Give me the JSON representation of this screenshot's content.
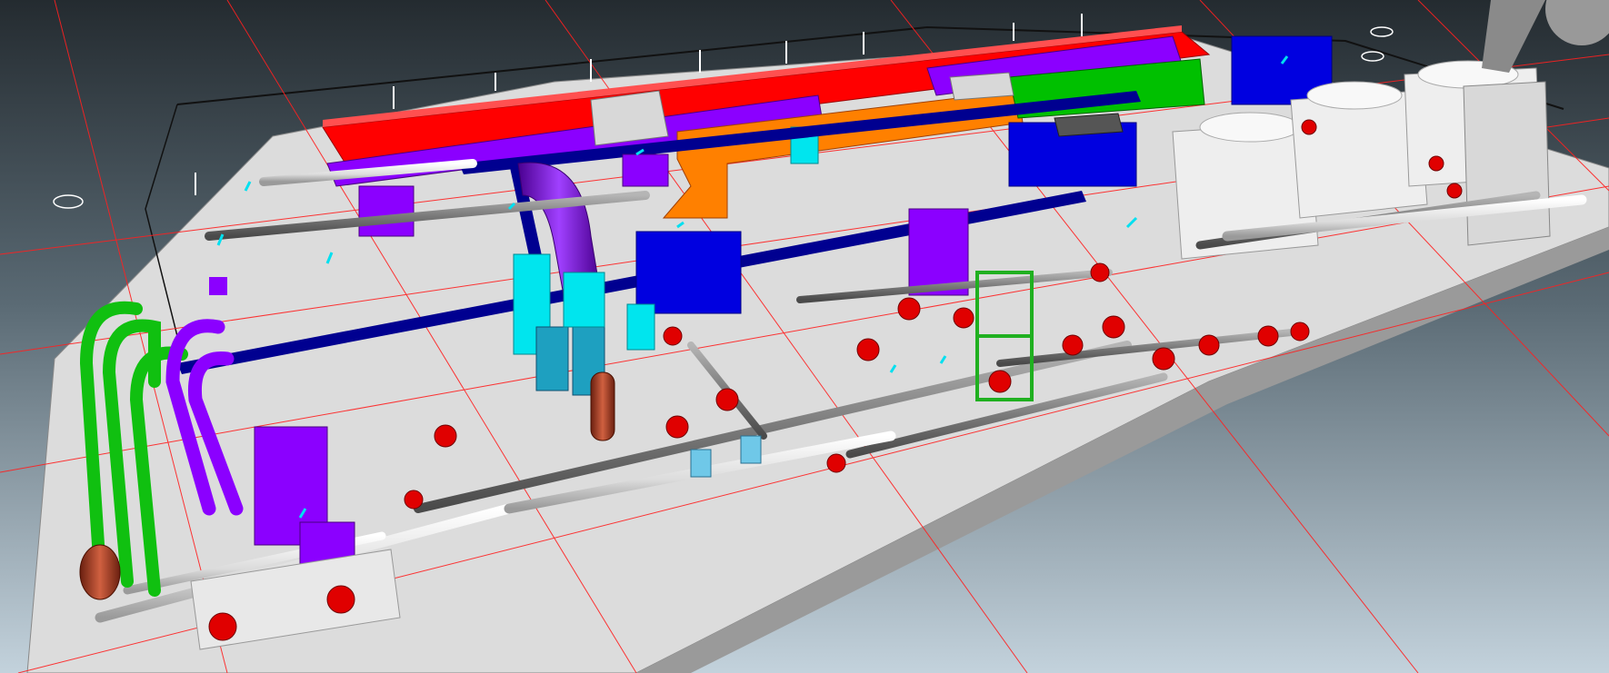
{
  "viewport": {
    "kind": "3d-model-view",
    "subject": "mechanical-electrical-plumbing-services-model",
    "background_top": "#2a3035",
    "background_bottom": "#bccbd5",
    "floor_color": "#dcdcdc",
    "grid_line_color": "#ff2020",
    "outline_color": "#111111"
  },
  "palette": {
    "supply_duct": "#ff0000",
    "return_duct": "#8b00ff",
    "exhaust_duct": "#0000ff",
    "outside_air_duct": "#ff8000",
    "green_pipe": "#00c000",
    "cyan_duct": "#00e5ee",
    "teal_duct": "#1ea0c0",
    "gray_pipe": "#7a7a7a",
    "white_pipe": "#e8e8e8",
    "red_fitting": "#e00000",
    "brown_tank": "#b04020",
    "navy_duct": "#000090",
    "equipment_white": "#eeeeee"
  },
  "model_elements": [
    {
      "type": "duct",
      "name": "supply-duct-main",
      "color": "#ff0000"
    },
    {
      "type": "duct",
      "name": "return-duct-main",
      "color": "#8b00ff"
    },
    {
      "type": "duct",
      "name": "outside-air-duct",
      "color": "#ff8000"
    },
    {
      "type": "duct",
      "name": "exhaust-duct",
      "color": "#0000ff"
    },
    {
      "type": "pipe",
      "name": "chilled-water-piping",
      "color": "#7a7a7a"
    },
    {
      "type": "pipe",
      "name": "condenser-water-piping",
      "color": "#e8e8e8"
    },
    {
      "type": "pipe",
      "name": "green-loop-piping",
      "color": "#00c000"
    },
    {
      "type": "pipe",
      "name": "purple-loop-piping",
      "color": "#8b00ff"
    },
    {
      "type": "equipment",
      "name": "cooling-tower",
      "color": "#eeeeee"
    },
    {
      "type": "equipment",
      "name": "pumps",
      "color": "#e00000"
    }
  ]
}
